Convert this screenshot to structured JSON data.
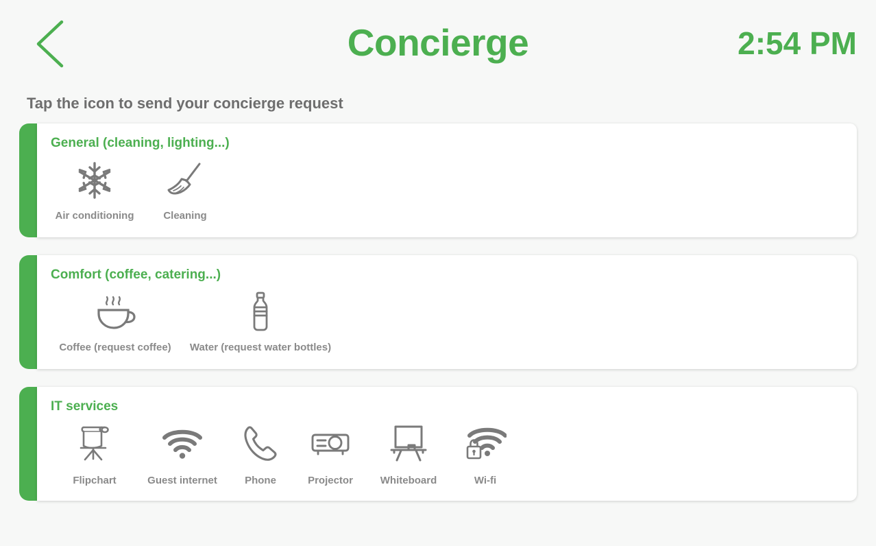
{
  "header": {
    "back_icon": "chevron-left-icon",
    "title": "Concierge",
    "clock": "2:54 PM",
    "accent_color": "#4CAF50"
  },
  "instruction": "Tap the icon to send your concierge request",
  "cards": [
    {
      "title": "General (cleaning, lighting...)",
      "accent_color": "#4CAF50",
      "items": [
        {
          "label": "Air conditioning",
          "icon": "snowflake-icon"
        },
        {
          "label": "Cleaning",
          "icon": "broom-icon"
        }
      ]
    },
    {
      "title": "Comfort (coffee, catering...)",
      "accent_color": "#4CAF50",
      "items": [
        {
          "label": "Coffee (request coffee)",
          "icon": "coffee-cup-icon"
        },
        {
          "label": "Water (request water bottles)",
          "icon": "water-bottle-icon"
        }
      ]
    },
    {
      "title": "IT services",
      "accent_color": "#4CAF50",
      "items": [
        {
          "label": "Flipchart",
          "icon": "flipchart-icon"
        },
        {
          "label": "Guest internet",
          "icon": "wifi-icon"
        },
        {
          "label": "Phone",
          "icon": "phone-icon"
        },
        {
          "label": "Projector",
          "icon": "projector-icon"
        },
        {
          "label": "Whiteboard",
          "icon": "whiteboard-icon"
        },
        {
          "label": "Wi-fi",
          "icon": "wifi-lock-icon"
        }
      ]
    }
  ],
  "colors": {
    "background": "#f7f8f7",
    "card": "#ffffff",
    "icon_gray": "#7a7a7a",
    "label_gray": "#8a8a8a",
    "instruction_gray": "#6e6e6e"
  }
}
